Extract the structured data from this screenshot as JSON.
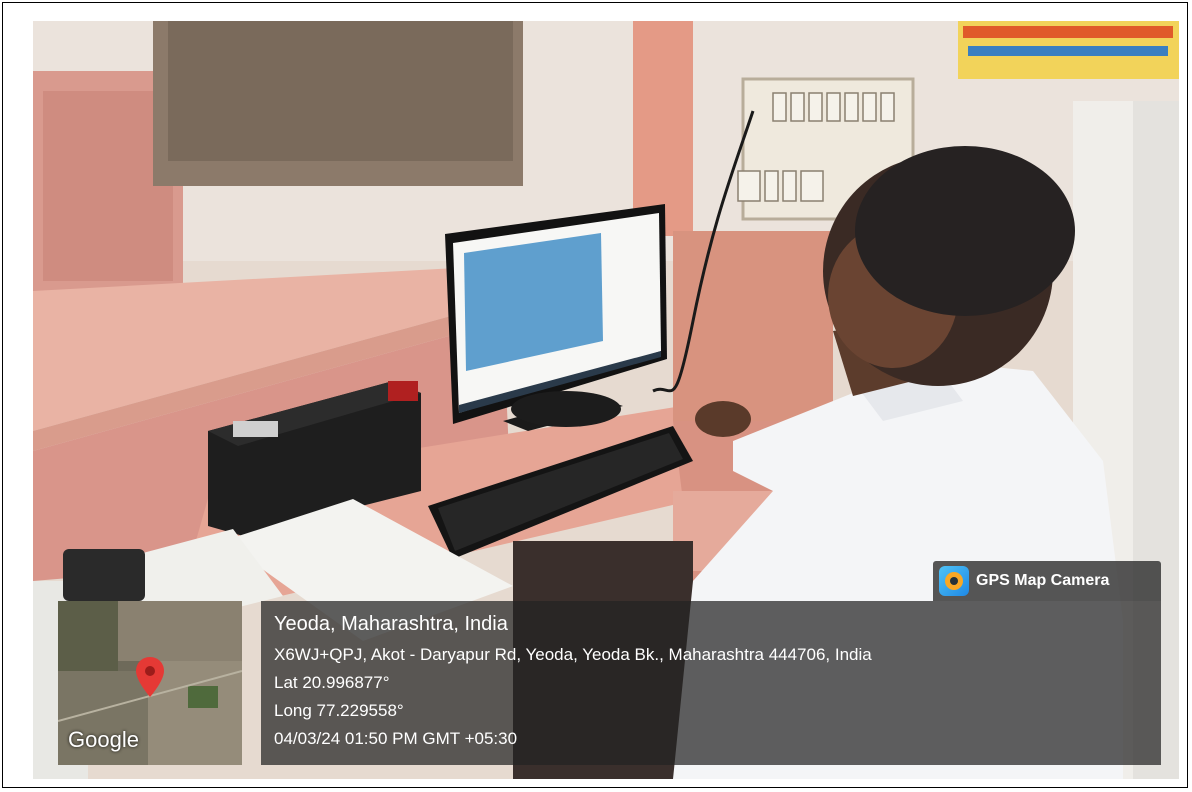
{
  "badge": {
    "label": "GPS Map Camera",
    "icon": "gps-camera-app-icon"
  },
  "location": {
    "title": "Yeoda, Maharashtra, India",
    "address": "X6WJ+QPJ, Akot - Daryapur Rd, Yeoda, Yeoda Bk., Maharashtra 444706, India",
    "lat": "Lat 20.996877°",
    "long": "Long 77.229558°",
    "datetime": "04/03/24 01:50 PM GMT +05:30"
  },
  "map": {
    "provider": "Google",
    "pin_icon": "map-pin-icon",
    "pin_color": "#e53935"
  },
  "photo": {
    "description_icon": "photo"
  },
  "colors": {
    "overlay": "#232323",
    "badge_bg": "#282828",
    "text": "#ffffff"
  }
}
